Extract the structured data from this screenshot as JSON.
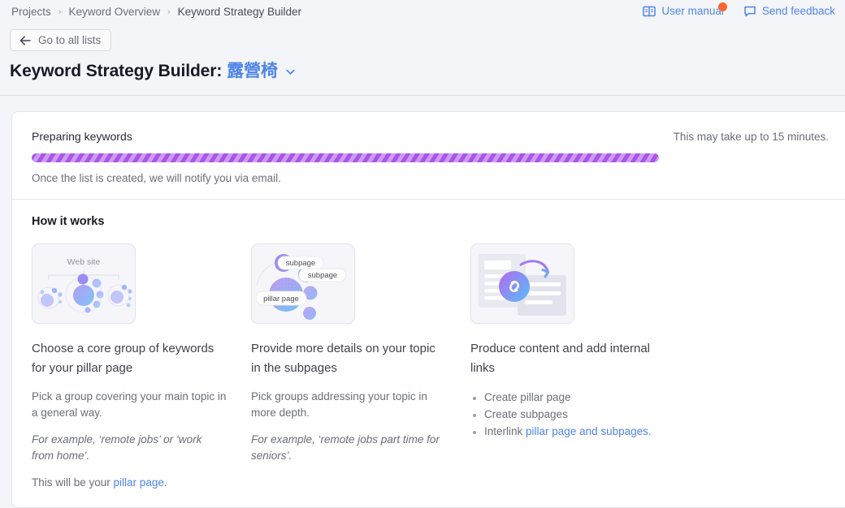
{
  "breadcrumb": {
    "items": [
      {
        "label": "Projects",
        "current": false
      },
      {
        "label": "Keyword Overview",
        "current": false
      },
      {
        "label": "Keyword Strategy Builder",
        "current": true
      }
    ],
    "separator": "›"
  },
  "topright": {
    "user_manual": {
      "label": "User manual",
      "icon": "book-icon",
      "badge": true
    },
    "send_feedback": {
      "label": "Send feedback",
      "icon": "speech-bubble-icon"
    }
  },
  "back_button": {
    "label": "Go to all lists",
    "icon": "arrow-left-icon"
  },
  "page_title": {
    "prefix": "Keyword Strategy Builder:",
    "keyword": "露營椅",
    "chevron": "chevron-down-icon"
  },
  "progress": {
    "status": "Preparing keywords",
    "eta": "This may take up to 15 minutes.",
    "note": "Once the list is created, we will notify you via email.",
    "bar_color": "#a855e8",
    "bar_track_color": "#ede6f9",
    "indeterminate": true
  },
  "how_it_works": {
    "title": "How it works",
    "columns": [
      {
        "illustration": "website-cluster-illustration",
        "illustration_label": "Web site",
        "heading": "Choose a core group of keywords for your pillar page",
        "paragraphs": [
          {
            "text": "Pick a group covering your main topic in a general way.",
            "italic": false
          },
          {
            "text": "For example, ‘remote jobs’ or ‘work from home’.",
            "italic": true
          }
        ],
        "closing_prefix": "This will be your ",
        "closing_link": "pillar page",
        "closing_suffix": "."
      },
      {
        "illustration": "subpages-cluster-illustration",
        "illustration_labels": [
          "subpage",
          "subpage",
          "pillar page"
        ],
        "heading": "Provide more details on your topic in the subpages",
        "paragraphs": [
          {
            "text": "Pick groups addressing your topic in more depth.",
            "italic": false
          },
          {
            "text": "For example, ‘remote jobs part time for seniors’.",
            "italic": true
          }
        ]
      },
      {
        "illustration": "internal-links-illustration",
        "heading": "Produce content and add internal links",
        "bullets": [
          {
            "text": "Create pillar page",
            "link": false
          },
          {
            "text": "Create subpages",
            "link": false
          },
          {
            "prefix": "Interlink ",
            "link_text": "pillar page and subpages.",
            "link": true
          }
        ]
      }
    ]
  },
  "colors": {
    "page_background": "#f4f5f9",
    "card_background": "#ffffff",
    "link": "#4f85e8",
    "accent_purple": "#a855e8",
    "notification": "#ff642d",
    "muted_text": "#6c6e79"
  }
}
